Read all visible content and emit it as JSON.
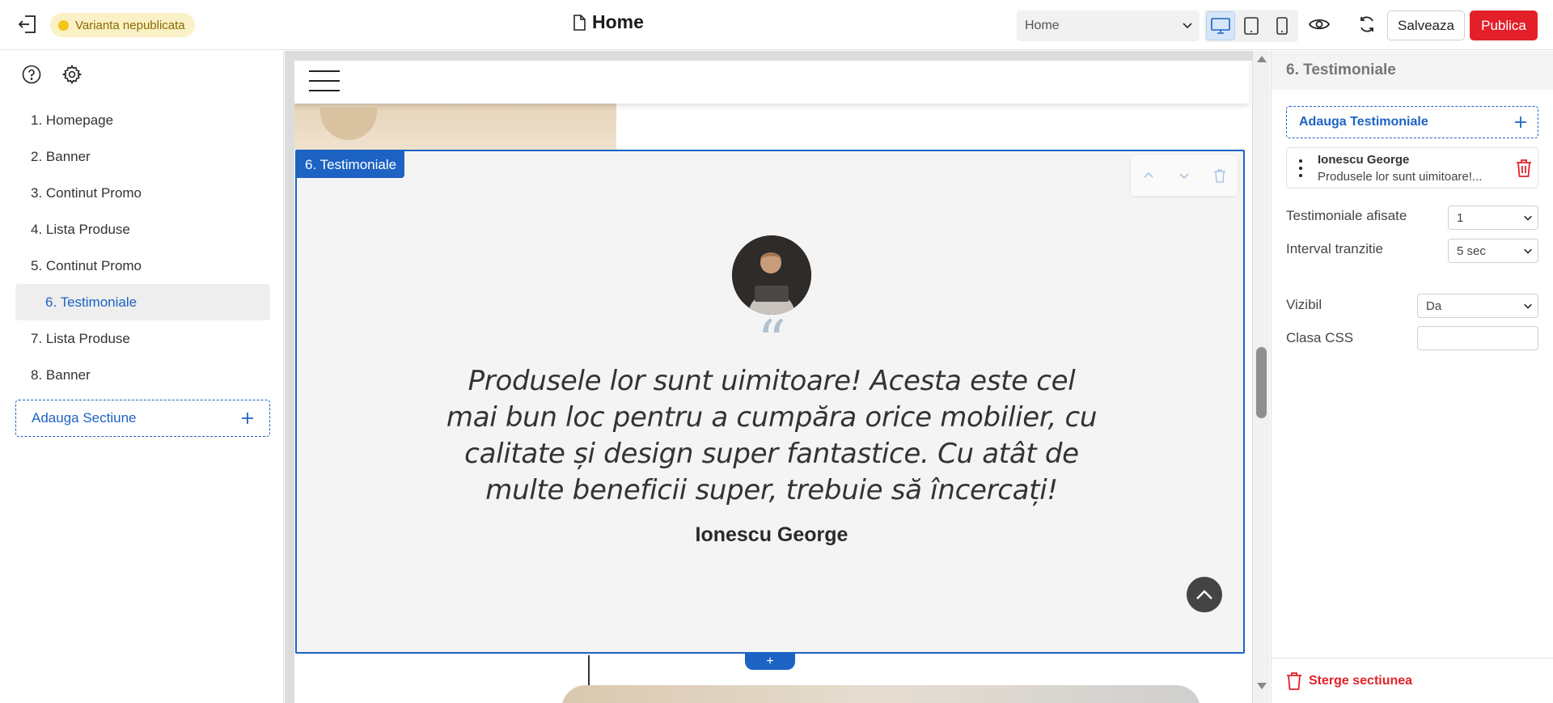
{
  "topbar": {
    "status_badge": "Varianta nepublicata",
    "page_title": "Home",
    "page_select_value": "Home",
    "save_label": "Salveaza",
    "publish_label": "Publica"
  },
  "sections": [
    {
      "label": "1. Homepage"
    },
    {
      "label": "2. Banner"
    },
    {
      "label": "3. Continut Promo"
    },
    {
      "label": "4. Lista Produse"
    },
    {
      "label": "5. Continut Promo"
    },
    {
      "label": "6. Testimoniale",
      "active": true
    },
    {
      "label": "7. Lista Produse"
    },
    {
      "label": "8. Banner"
    }
  ],
  "add_section_label": "Adauga Sectiune",
  "canvas": {
    "section_label": "6. Testimoniale",
    "quote": "Produsele lor sunt uimitoare! Acesta este cel mai bun loc pentru a cumpăra orice mobilier, cu calitate și design super fantastice. Cu atât de multe beneficii super, trebuie să încercați!",
    "author": "Ionescu George",
    "add_between_label": "+"
  },
  "panel": {
    "title": "6. Testimoniale",
    "add_label": "Adauga Testimoniale",
    "item": {
      "name": "Ionescu George",
      "excerpt": "Produsele lor sunt uimitoare!..."
    },
    "shown_label": "Testimoniale afisate",
    "shown_value": "1",
    "interval_label": "Interval tranzitie",
    "interval_value": "5 sec",
    "visible_label": "Vizibil",
    "visible_value": "Da",
    "css_label": "Clasa CSS",
    "css_value": "",
    "delete_label": "Sterge sectiunea"
  },
  "colors": {
    "accent": "#1d63c4",
    "danger": "#e3202a",
    "badge_bg": "#fbf1c6"
  }
}
